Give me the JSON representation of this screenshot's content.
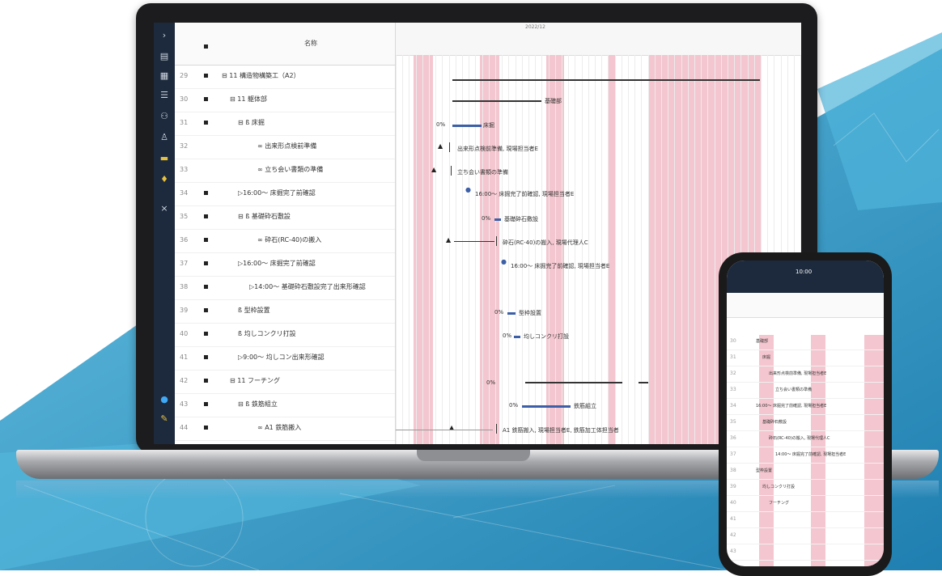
{
  "colors": {
    "accent": "#3c5fa7",
    "holiday": "#f4c6cf",
    "nav": "#1d2a3d",
    "background_blue": "#3fa3cf"
  },
  "nav": {
    "icons": [
      "chevron-right-icon",
      "list-icon",
      "calendar-icon",
      "list-indent-icon",
      "org-icon",
      "user-icon",
      "folder-icon",
      "bulb-icon",
      "close-icon",
      "status-dot-icon",
      "pen-icon"
    ]
  },
  "table": {
    "header_name": "名称",
    "rows": [
      {
        "num": "29",
        "text": "⊟ 11 構造物構築工（A2）"
      },
      {
        "num": "30",
        "text": "⊟ 11 躯体部"
      },
      {
        "num": "31",
        "text": "⊟ ß 床掘"
      },
      {
        "num": "32",
        "text": "∞ 出来形点検前準備"
      },
      {
        "num": "33",
        "text": "∞ 立ち会い書類の準備"
      },
      {
        "num": "34",
        "text": "▷16:00～ 床掘完了前確認"
      },
      {
        "num": "35",
        "text": "⊟ ß 基礎砕石敷設"
      },
      {
        "num": "36",
        "text": "∞ 砕石(RC-40)の搬入"
      },
      {
        "num": "37",
        "text": "▷16:00～ 床掘完了前確認"
      },
      {
        "num": "38",
        "text": "▷14:00～ 基礎砕石敷設完了出来形確認"
      },
      {
        "num": "39",
        "text": "ß 型枠設置"
      },
      {
        "num": "40",
        "text": "ß 均しコンクリ打設"
      },
      {
        "num": "41",
        "text": "▷9:00～ 均しコン出来形確認"
      },
      {
        "num": "42",
        "text": "⊟ 11 フーチング"
      },
      {
        "num": "43",
        "text": "⊟ ß 鉄筋組立"
      },
      {
        "num": "44",
        "text": "∞ A1 鉄筋搬入"
      }
    ]
  },
  "gantt": {
    "month": "2022/12",
    "labels": [
      "基礎部",
      "床掘",
      "出来形点検前準備, 現場担当者E",
      "立ち会い書類の準備",
      "16:00～ 床掘完了前確認, 現場担当者E",
      "基礎砕石敷設",
      "砕石(RC-40)の搬入, 現場代理人C",
      "16:00～ 床掘完了前確認, 現場担当者E",
      "型枠設置",
      "均しコンクリ打設",
      "鉄筋組立",
      "A1 鉄筋搬入, 現場担当者E, 鉄筋加工体担当者"
    ],
    "pcts": [
      "0%",
      "0%",
      "0%",
      "0%",
      "0%",
      "0%"
    ]
  },
  "phone": {
    "time": "10:00",
    "labels": [
      "基礎部",
      "床掘",
      "出来形点検前準備, 現場担当者E",
      "立ち会い書類の準備",
      "16:00～ 床掘完了前確認, 現場担当者E",
      "基礎砕石敷設",
      "砕石(RC-40)の搬入, 現場代理人C",
      "14:00～ 床掘完了前確認, 現場担当者E",
      "型枠設置",
      "均しコンクリ打設",
      "フーチング"
    ],
    "nums": [
      "30",
      "31",
      "32",
      "33",
      "34",
      "35",
      "36",
      "37",
      "38",
      "39",
      "40",
      "41",
      "42",
      "43"
    ]
  }
}
